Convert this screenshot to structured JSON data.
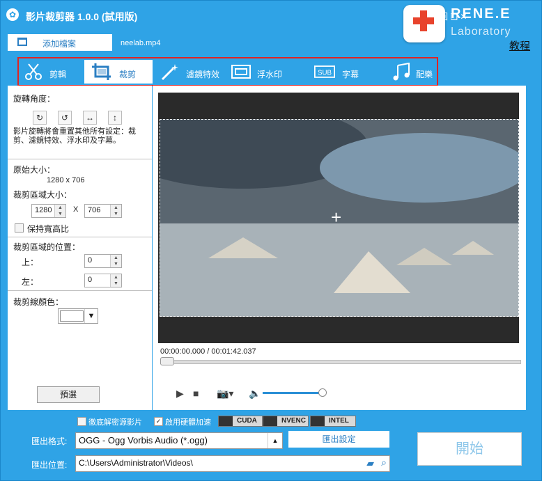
{
  "window": {
    "title": "影片裁剪器 1.0.0 (試用版)"
  },
  "brand": {
    "name": "RENE.E",
    "sub": "Laboratory"
  },
  "tutorial_link": "教程",
  "add_file_label": "添加檔案",
  "file_name": "neelab.mp4",
  "toolbar": [
    {
      "label": "剪輯",
      "icon": "cut-icon"
    },
    {
      "label": "裁剪",
      "icon": "crop-icon",
      "active": true
    },
    {
      "label": "濾鏡特效",
      "icon": "magic-wand-icon"
    },
    {
      "label": "浮水印",
      "icon": "watermark-icon"
    },
    {
      "label": "字幕",
      "icon": "subtitle-icon"
    },
    {
      "label": "配樂",
      "icon": "music-icon"
    }
  ],
  "left_panel": {
    "rotation_title": "旋轉角度：",
    "rotation_note": "影片旋轉將會重置其他所有設定：裁剪、濾鏡特效、浮水印及字幕。",
    "original_size_label": "原始大小：",
    "original_size_value": "1280 x 706",
    "crop_size_label": "裁剪區域大小：",
    "width_value": "1280",
    "x_sep": "X",
    "height_value": "706",
    "keep_ratio_label": "保持寬高比",
    "position_label": "裁剪區域的位置：",
    "top_label": "上：",
    "top_value": "0",
    "left_label": "左：",
    "left_value": "0",
    "line_color_label": "裁剪線顏色：",
    "preset_button": "預選"
  },
  "player": {
    "timecode": "00:00:00.000 / 00:01:42.037"
  },
  "bottom": {
    "deinterlace_label": "徹底解密源影片",
    "hw_accel_label": "啟用硬體加速",
    "gpu_badges": [
      "CUDA",
      "NVENC",
      "INTEL"
    ],
    "format_label": "匯出格式:",
    "format_value": "OGG - Ogg Vorbis Audio (*.ogg)",
    "output_settings_button": "匯出設定",
    "output_path_label": "匯出位置:",
    "output_path_value": "C:\\Users\\Administrator\\Videos\\",
    "start_button": "開始"
  },
  "colors": {
    "accent": "#2fa3e6",
    "highlight": "#e02424"
  }
}
